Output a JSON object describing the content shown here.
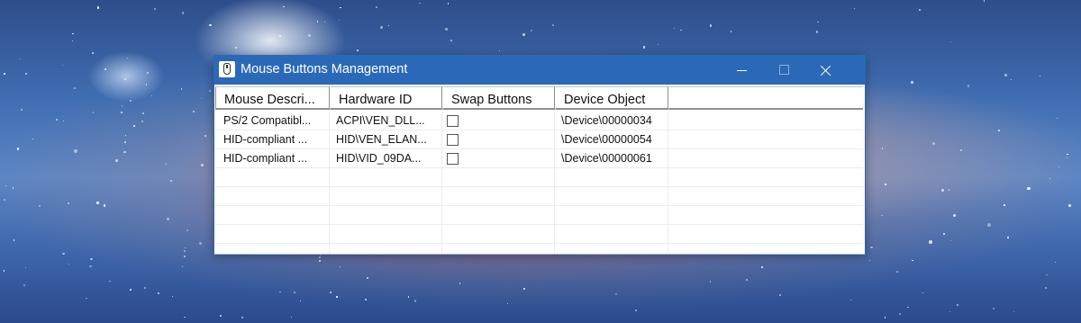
{
  "window": {
    "title": "Mouse Buttons Management",
    "icon": "mouse-app-icon",
    "accent_color": "#2b69b8"
  },
  "table": {
    "columns": [
      "Mouse Descri...",
      "Hardware ID",
      "Swap Buttons",
      "Device Object"
    ],
    "rows": [
      {
        "description": "PS/2 Compatibl...",
        "hardware_id": "ACPI\\VEN_DLL...",
        "swap_buttons": false,
        "device_object": "\\Device\\00000034"
      },
      {
        "description": "HID-compliant ...",
        "hardware_id": "HID\\VEN_ELAN...",
        "swap_buttons": false,
        "device_object": "\\Device\\00000054"
      },
      {
        "description": "HID-compliant ...",
        "hardware_id": "HID\\VID_09DA...",
        "swap_buttons": false,
        "device_object": "\\Device\\00000061"
      }
    ]
  }
}
